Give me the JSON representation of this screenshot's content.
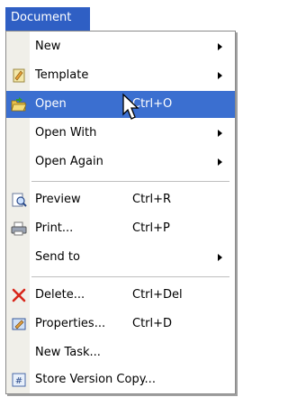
{
  "menubar": {
    "title": "Document"
  },
  "menu": {
    "items": [
      {
        "label": "New",
        "shortcut": ""
      },
      {
        "label": "Template",
        "shortcut": "",
        "icon": "template-icon"
      },
      {
        "label": "Open",
        "shortcut": "Ctrl+O",
        "icon": "open-folder-icon"
      },
      {
        "label": "Open With",
        "shortcut": ""
      },
      {
        "label": "Open Again",
        "shortcut": ""
      },
      {
        "label": "Preview",
        "shortcut": "Ctrl+R",
        "icon": "preview-icon"
      },
      {
        "label": "Print...",
        "shortcut": "Ctrl+P",
        "icon": "printer-icon"
      },
      {
        "label": "Send to",
        "shortcut": ""
      },
      {
        "label": "Delete...",
        "shortcut": "Ctrl+Del",
        "icon": "delete-x-icon"
      },
      {
        "label": "Properties...",
        "shortcut": "Ctrl+D",
        "icon": "properties-icon"
      },
      {
        "label": "New Task...",
        "shortcut": ""
      },
      {
        "label": "Store Version Copy...",
        "shortcut": "",
        "icon": "version-icon"
      }
    ]
  },
  "colors": {
    "highlight": "#3b6fd0",
    "menubar": "#2f5fc4"
  }
}
